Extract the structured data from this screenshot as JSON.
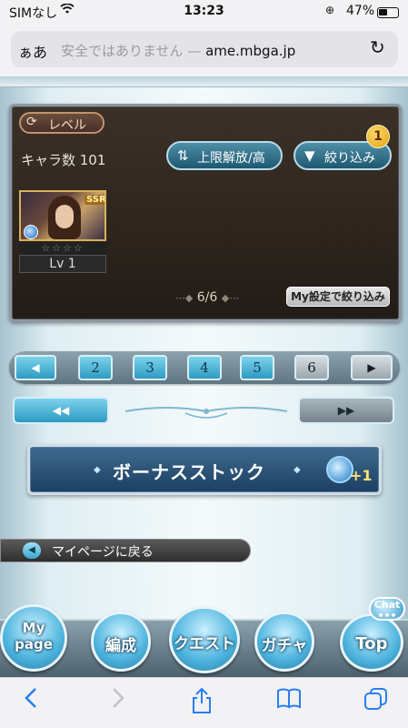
{
  "statusbar": {
    "carrier": "SIMなし",
    "wifi": "wifi",
    "time": "13:23",
    "battery": "47%"
  },
  "browser": {
    "aa": "ぁあ",
    "warning": "安全ではありません —",
    "domain": "ame.mbga.jp",
    "reload": "↻"
  },
  "panel": {
    "sort_label": "レベル",
    "chara_count": "キャラ数 101",
    "limit_button": "上限解放/高",
    "filter_button": "絞り込み",
    "filter_badge": "1",
    "card": {
      "rarity": "SSR",
      "stars": "☆☆☆☆",
      "level": "Lv 1"
    },
    "page_info": "6/6",
    "my_settings_button": "My設定で絞り込み"
  },
  "pagination": {
    "prev": "◀",
    "pages": [
      "2",
      "3",
      "4",
      "5",
      "6"
    ],
    "current_page": "6",
    "next": "▶",
    "first": "◀◀",
    "last": "▶▶"
  },
  "bonus_stock": {
    "label": "ボーナスストック",
    "plus": "+1"
  },
  "back_to_mypage": "マイページに戻る",
  "game_nav": {
    "mypage_line1": "My",
    "mypage_line2": "page",
    "hensei": "編成",
    "quest": "クエスト",
    "gacha": "ガチャ",
    "top": "Top",
    "chat": "Chat",
    "chat_dots": "•••"
  },
  "colors": {
    "accent_blue": "#2d9bc2",
    "panel_bg": "#2b231c",
    "safari_blue": "#2a7ef0"
  },
  "toolbar_icons": [
    "back-icon",
    "forward-icon",
    "share-icon",
    "bookmarks-icon",
    "tabs-icon"
  ]
}
